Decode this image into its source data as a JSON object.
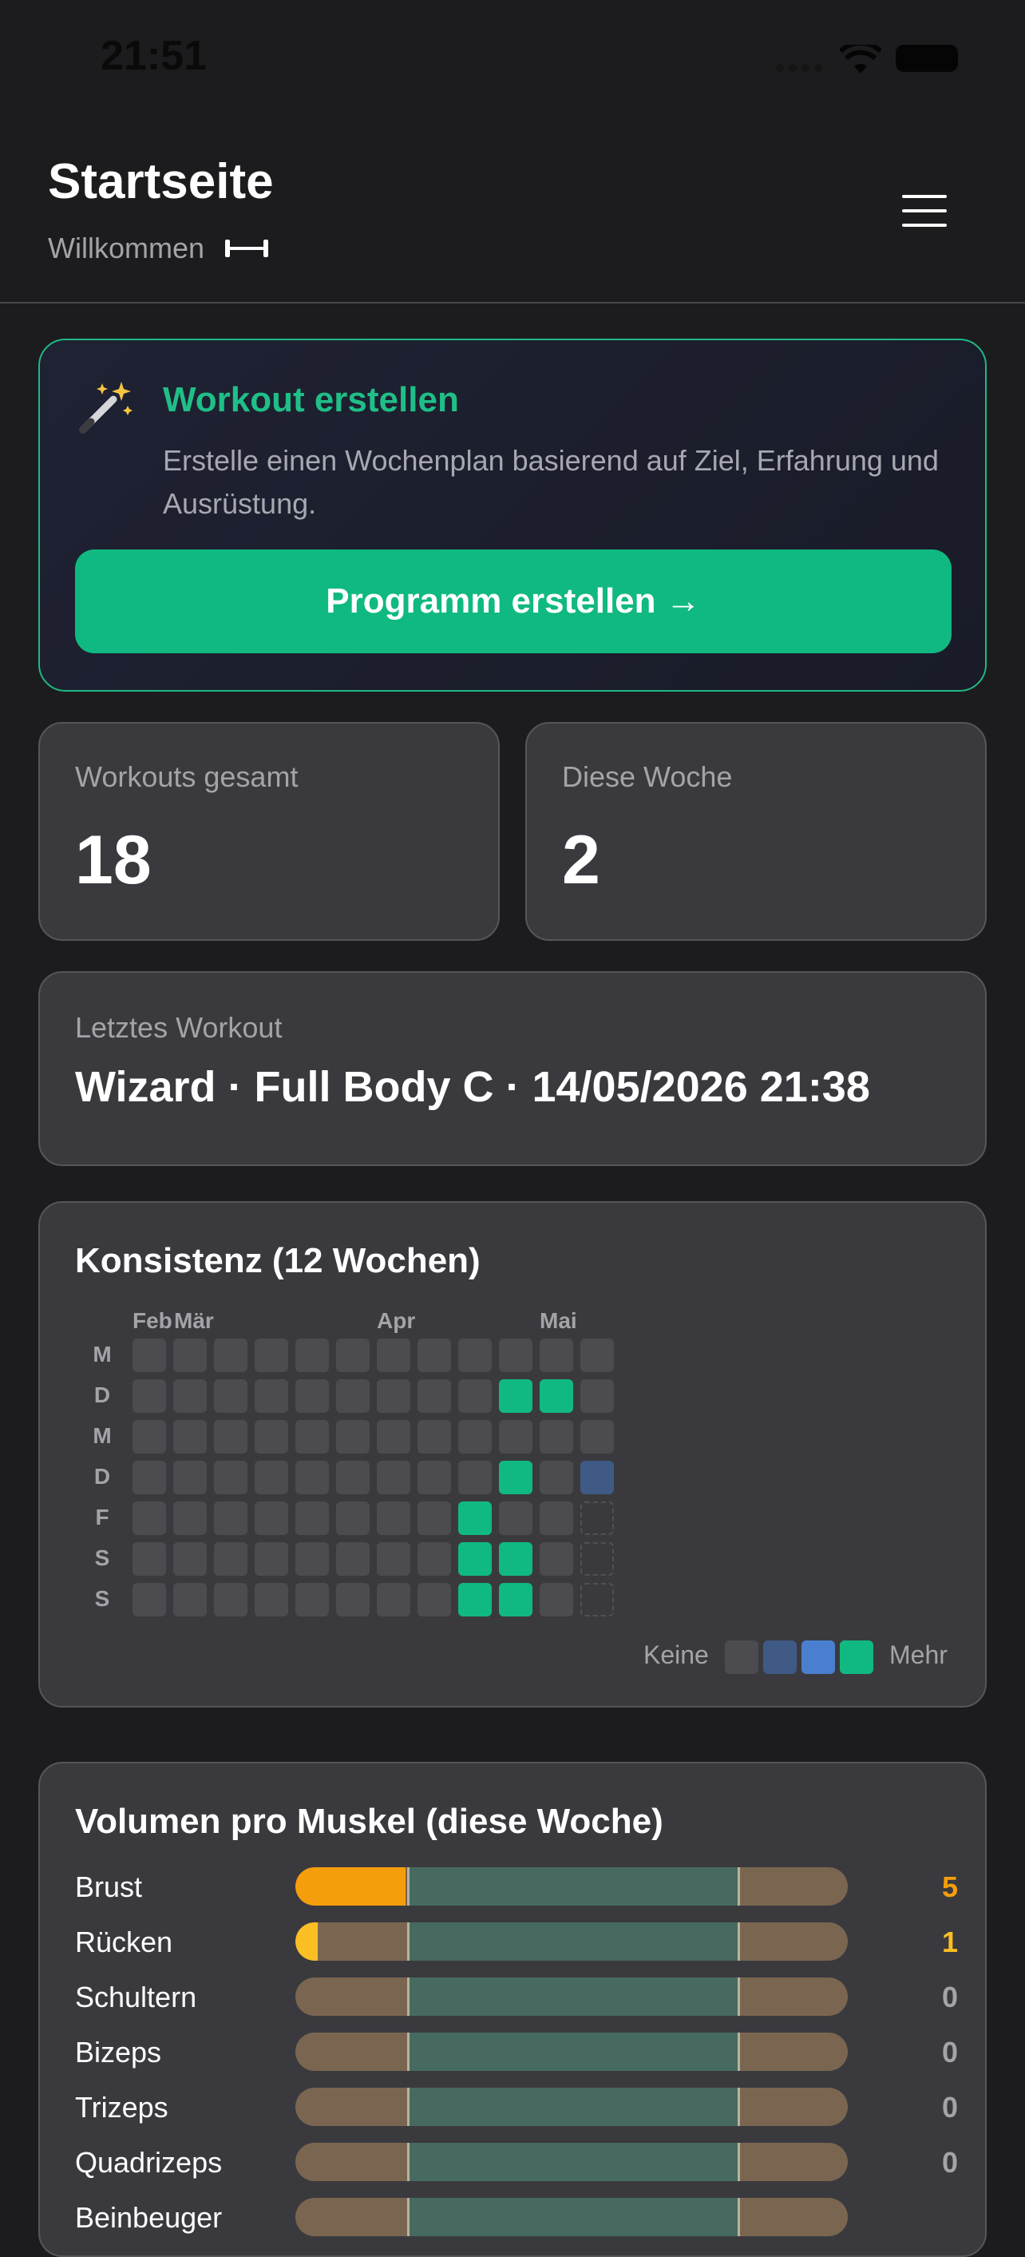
{
  "status_bar": {
    "time": "21:51"
  },
  "header": {
    "title": "Startseite",
    "subtitle": "Willkommen"
  },
  "wizard": {
    "title": "Workout erstellen",
    "description": "Erstelle einen Wochenplan basierend auf Ziel, Erfahrung und Ausrüstung.",
    "button_label": "Programm erstellen →"
  },
  "stats": [
    {
      "label": "Workouts gesamt",
      "value": "18"
    },
    {
      "label": "Diese Woche",
      "value": "2"
    }
  ],
  "last_workout": {
    "label": "Letztes Workout",
    "value": "Wizard · Full Body C · 14/05/2026 21:38"
  },
  "consistency": {
    "title": "Konsistenz (12 Wochen)",
    "months": [
      "Feb",
      "Mär",
      "Apr",
      "Mai"
    ],
    "days": [
      "M",
      "D",
      "M",
      "D",
      "F",
      "S",
      "S"
    ],
    "grid": [
      [
        0,
        0,
        0,
        0,
        0,
        0,
        0,
        0,
        0,
        0,
        0,
        0
      ],
      [
        0,
        0,
        0,
        0,
        0,
        0,
        0,
        0,
        0,
        3,
        3,
        0
      ],
      [
        0,
        0,
        0,
        0,
        0,
        0,
        0,
        0,
        0,
        0,
        0,
        0
      ],
      [
        0,
        0,
        0,
        0,
        0,
        0,
        0,
        0,
        0,
        3,
        0,
        1
      ],
      [
        0,
        0,
        0,
        0,
        0,
        0,
        0,
        0,
        3,
        0,
        0,
        -1
      ],
      [
        0,
        0,
        0,
        0,
        0,
        0,
        0,
        0,
        3,
        3,
        0,
        -1
      ],
      [
        0,
        0,
        0,
        0,
        0,
        0,
        0,
        0,
        3,
        3,
        0,
        -1
      ]
    ],
    "legend_less": "Keine",
    "legend_more": "Mehr",
    "legend_colors": [
      "#4b4b50",
      "#3f5a85",
      "#4a7fcf",
      "#10b981"
    ]
  },
  "volume": {
    "title": "Volumen pro Muskel (diese Woche)",
    "muscles": [
      {
        "name": "Brust",
        "count": "5",
        "fill": 0.2,
        "color": "#f59e0b"
      },
      {
        "name": "Rücken",
        "count": "1",
        "fill": 0.04,
        "color": "#fbbf24"
      },
      {
        "name": "Schultern",
        "count": "0",
        "fill": 0,
        "color": ""
      },
      {
        "name": "Bizeps",
        "count": "0",
        "fill": 0,
        "color": ""
      },
      {
        "name": "Trizeps",
        "count": "0",
        "fill": 0,
        "color": ""
      },
      {
        "name": "Quadrizeps",
        "count": "0",
        "fill": 0,
        "color": ""
      },
      {
        "name": "Beinbeuger",
        "count": "",
        "fill": 0,
        "color": ""
      }
    ]
  }
}
